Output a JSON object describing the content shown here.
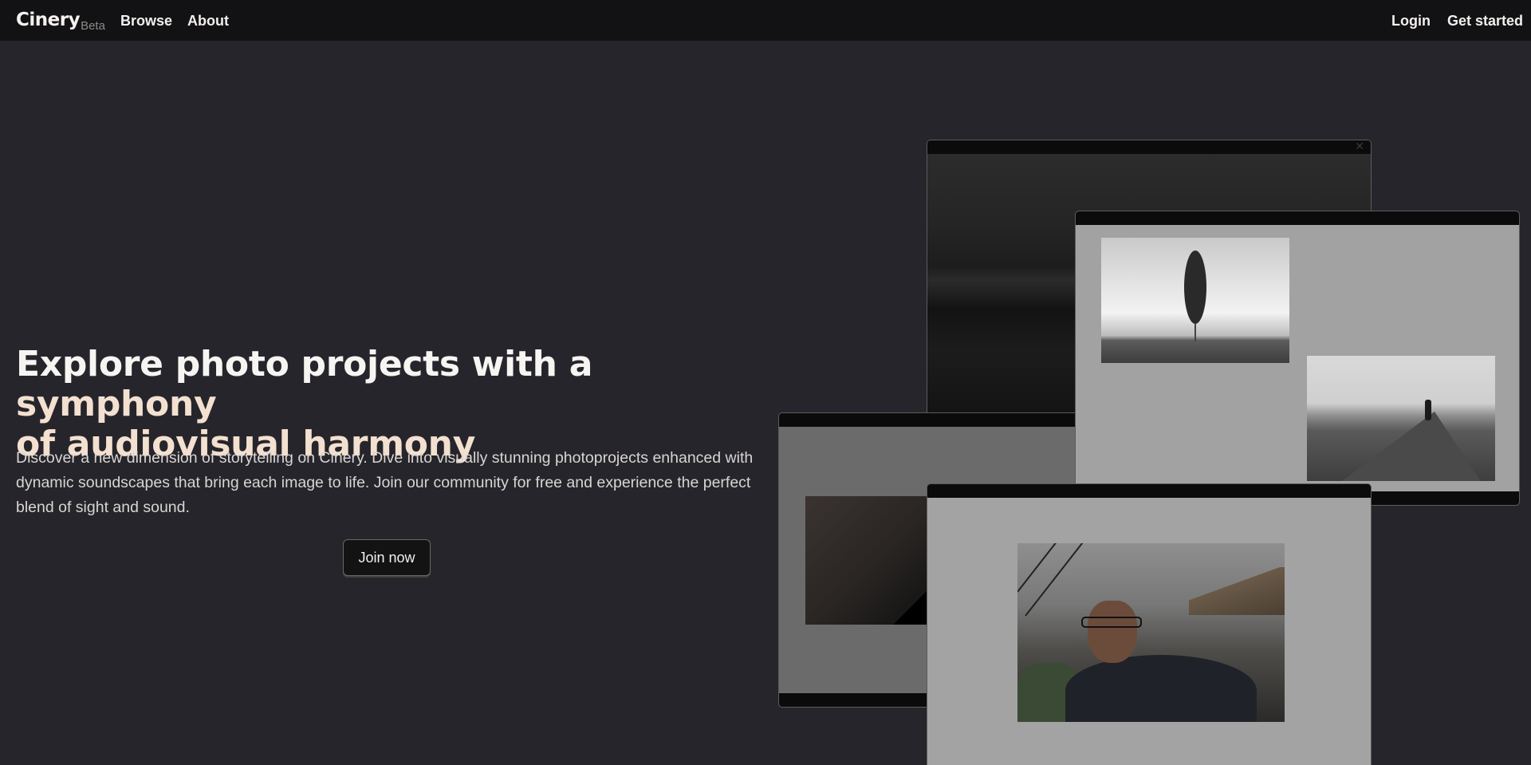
{
  "nav": {
    "brand": "Cinery",
    "brand_tag": "Beta",
    "links": [
      "Browse",
      "About"
    ],
    "login": "Login",
    "get_started": "Get started"
  },
  "hero": {
    "title_main": "Explore photo projects with a ",
    "title_accent_1": "symphony",
    "title_line2_accent": "of audiovisual harmony",
    "description": "Discover a new dimension of storytelling on Cinery. Dive into visually stunning photoprojects enhanced with dynamic soundscapes that bring each image to life. Join our community for free and experience the perfect blend of sight and sound.",
    "cta": "Join now"
  },
  "mockups": {
    "close_glyph": "✕"
  },
  "colors": {
    "background": "#26252b",
    "navbar": "#121214",
    "accent_text": "#f3e0d0"
  }
}
